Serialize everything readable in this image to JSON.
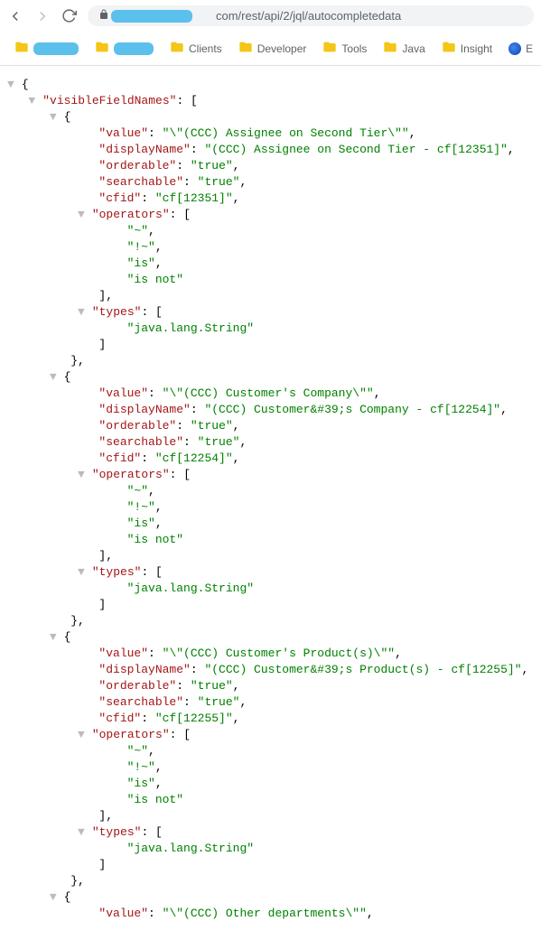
{
  "browser": {
    "url_visible": "com/rest/api/2/jql/autocompletedata",
    "bookmarks": [
      {
        "label": "",
        "icon": "folder",
        "redacted": true
      },
      {
        "label": "",
        "icon": "folder",
        "redacted": true
      },
      {
        "label": "Clients",
        "icon": "folder"
      },
      {
        "label": "Developer",
        "icon": "folder"
      },
      {
        "label": "Tools",
        "icon": "folder"
      },
      {
        "label": "Java",
        "icon": "folder"
      },
      {
        "label": "Insight",
        "icon": "folder"
      },
      {
        "label": "E",
        "icon": "circle"
      }
    ]
  },
  "json": {
    "root_key": "visibleFieldNames",
    "entries": [
      {
        "value": "\\\"(CCC) Assignee on Second Tier\\\"",
        "displayName": "(CCC) Assignee on Second Tier - cf[12351]",
        "orderable": "true",
        "searchable": "true",
        "cfid": "cf[12351]",
        "operators": [
          "~",
          "!~",
          "is",
          "is not"
        ],
        "types": [
          "java.lang.String"
        ]
      },
      {
        "value": "\\\"(CCC) Customer's Company\\\"",
        "displayName": "(CCC) Customer&#39;s Company - cf[12254]",
        "orderable": "true",
        "searchable": "true",
        "cfid": "cf[12254]",
        "operators": [
          "~",
          "!~",
          "is",
          "is not"
        ],
        "types": [
          "java.lang.String"
        ]
      },
      {
        "value": "\\\"(CCC) Customer's Product(s)\\\"",
        "displayName": "(CCC) Customer&#39;s Product(s) - cf[12255]",
        "orderable": "true",
        "searchable": "true",
        "cfid": "cf[12255]",
        "operators": [
          "~",
          "!~",
          "is",
          "is not"
        ],
        "types": [
          "java.lang.String"
        ]
      },
      {
        "value": "\\\"(CCC) Other departments\\\"",
        "partial": true
      }
    ],
    "labels": {
      "value": "value",
      "displayName": "displayName",
      "orderable": "orderable",
      "searchable": "searchable",
      "cfid": "cfid",
      "operators": "operators",
      "types": "types"
    }
  }
}
